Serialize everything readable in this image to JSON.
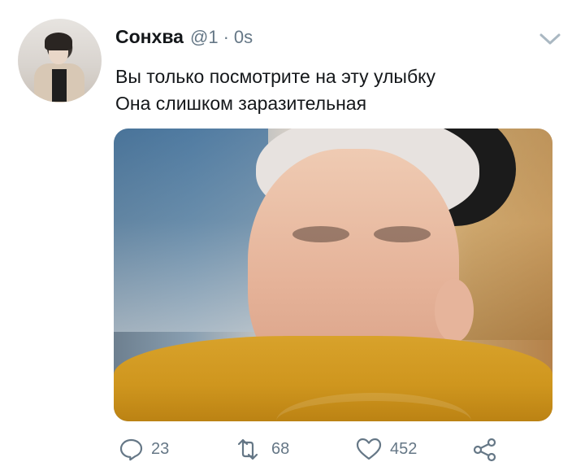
{
  "tweet": {
    "author": {
      "display_name": "Сонхва",
      "handle": "@1",
      "separator": "·",
      "time": "0s",
      "avatar_icon": "user-avatar"
    },
    "text_lines": [
      "Вы только посмотрите на эту улыбку",
      "Она слишком заразительная"
    ],
    "media": {
      "type": "photo",
      "description_icon": "photo-smiling-person"
    },
    "actions": {
      "reply_count": "23",
      "retweet_count": "68",
      "like_count": "452"
    },
    "icons": {
      "menu": "chevron-down-icon",
      "reply": "reply-icon",
      "retweet": "retweet-icon",
      "like": "heart-icon",
      "share": "share-icon"
    },
    "colors": {
      "text": "#14171a",
      "muted": "#657786"
    }
  }
}
